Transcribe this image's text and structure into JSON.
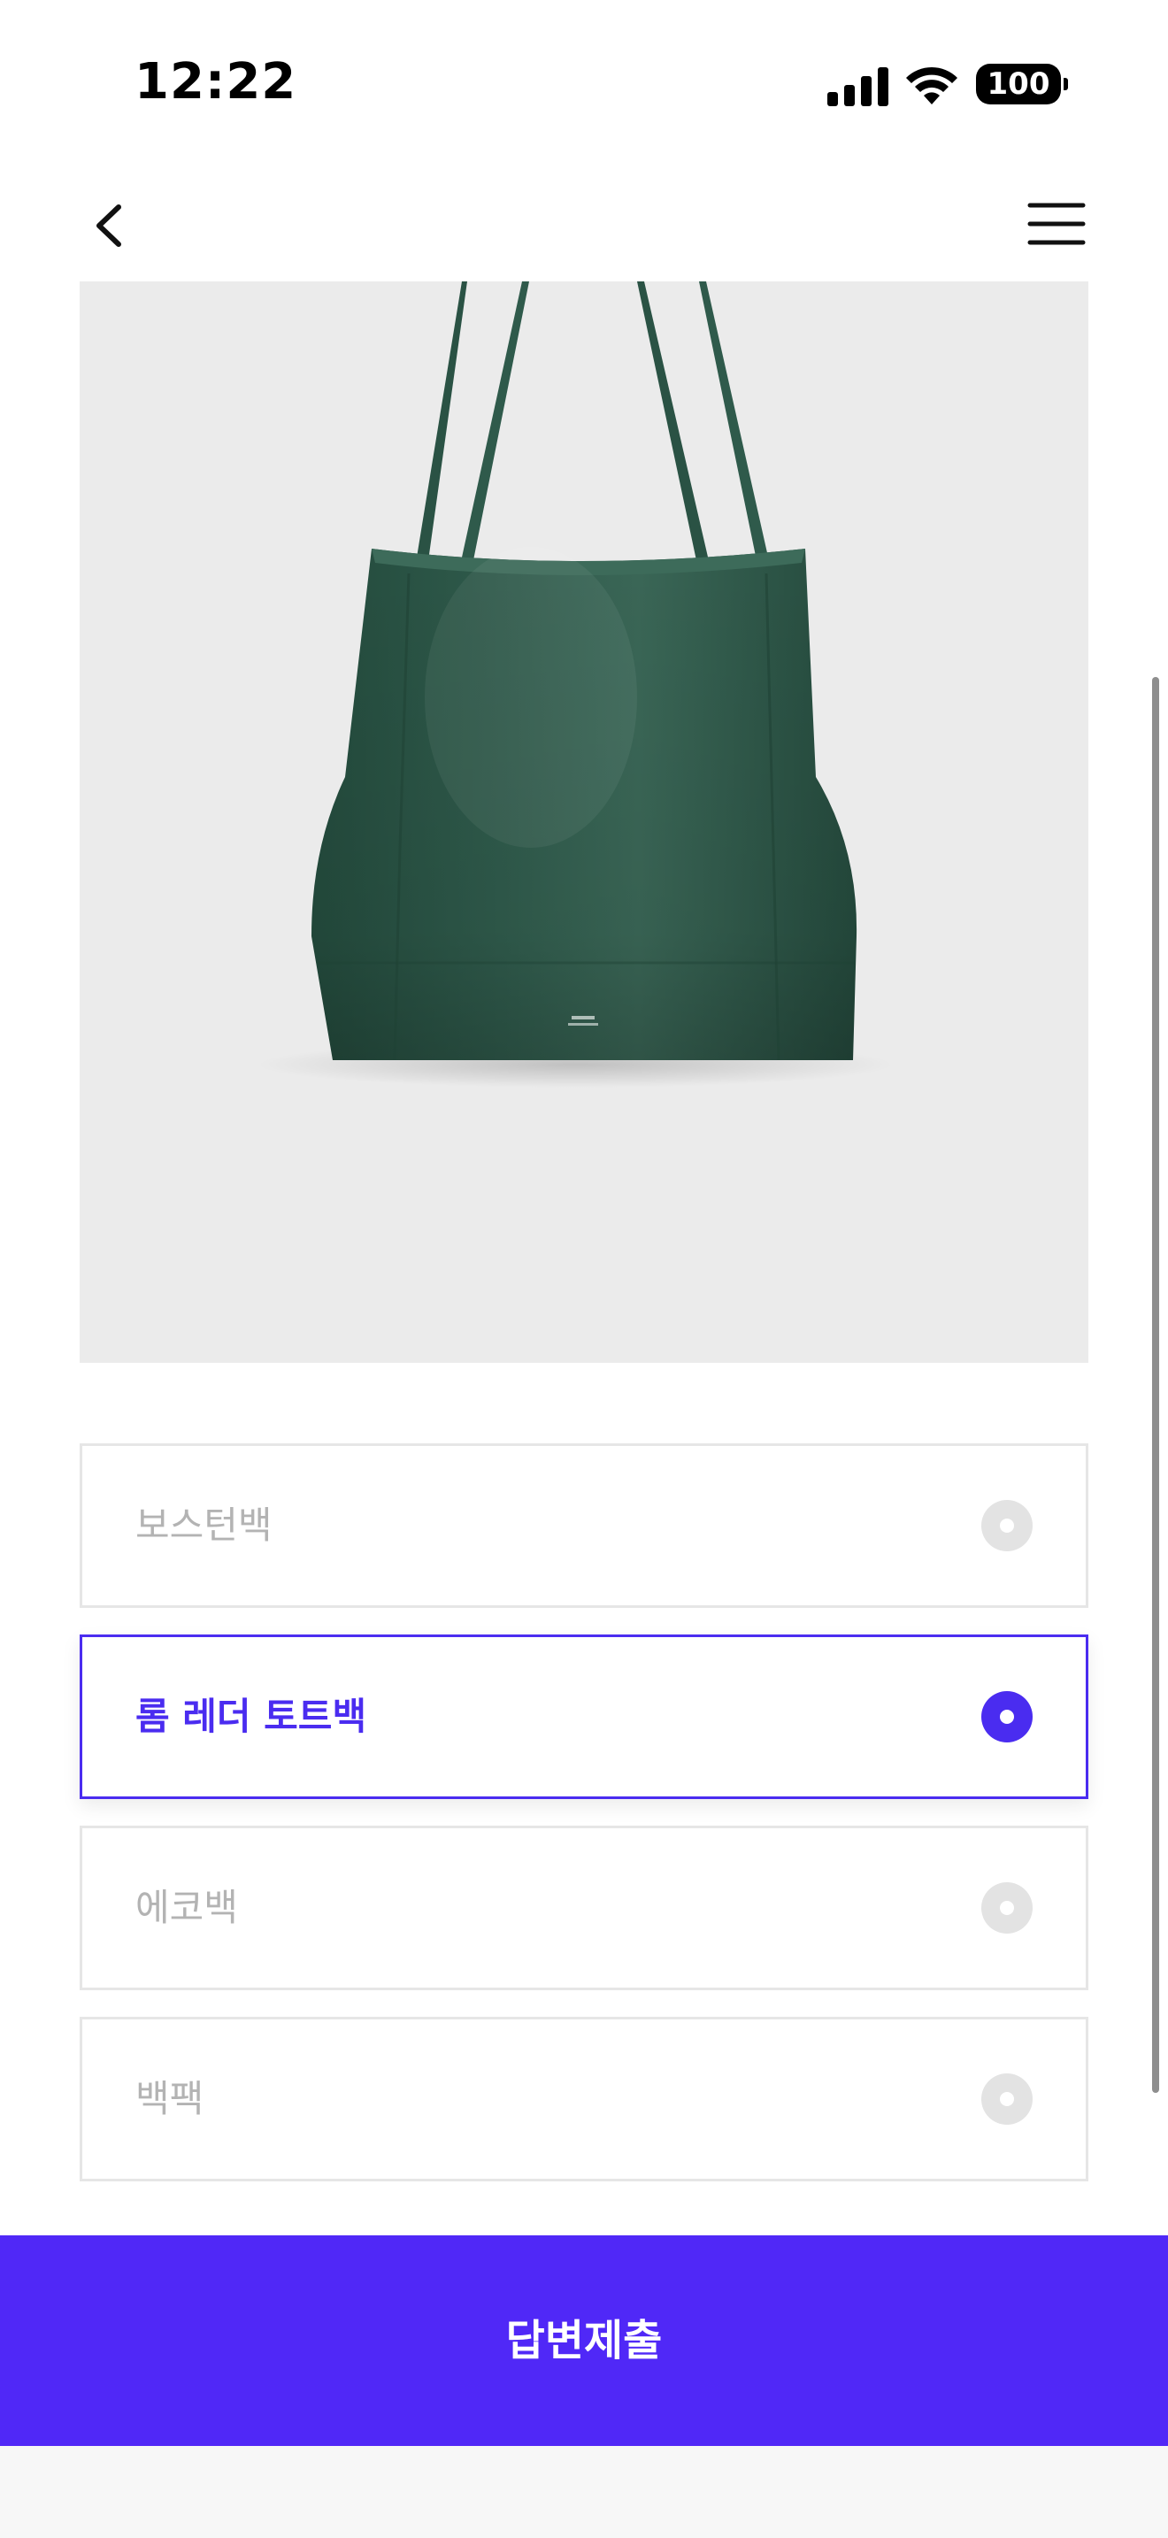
{
  "status_bar": {
    "time": "12:22",
    "battery": "100",
    "icons": [
      "signal-icon",
      "wifi-icon",
      "battery-icon"
    ]
  },
  "nav": {
    "icons": [
      "chevron-left-icon",
      "hamburger-menu-icon"
    ]
  },
  "product": {
    "image": "green-leather-tote-bag",
    "bag_color": "#2f5a4a"
  },
  "options": [
    {
      "label": "보스턴백",
      "selected": false
    },
    {
      "label": "롬 레더 토트백",
      "selected": true
    },
    {
      "label": "에코백",
      "selected": false
    },
    {
      "label": "백팩",
      "selected": false
    }
  ],
  "submit": {
    "label": "답변제출"
  },
  "colors": {
    "accent": "#4a2cf0",
    "submit_bg": "#5028f7",
    "unselected_text": "#b3b3b3",
    "border": "#e6e6e6"
  }
}
